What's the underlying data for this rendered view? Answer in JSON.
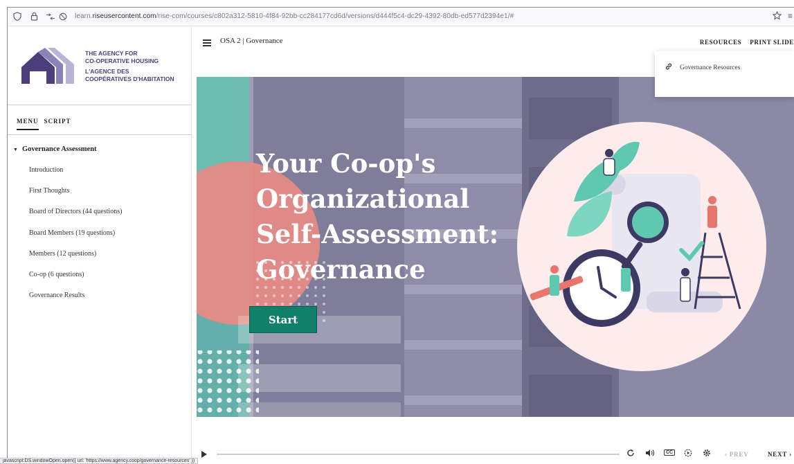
{
  "browser": {
    "url_prefix": "learn.",
    "url_domain": "riseusercontent.com",
    "url_path": "/rise-com/courses/c802a312-5810-4f84-92bb-cc284177cd6d/versions/d444f5c4-dc29-4392-80db-ed577d2394e1/#",
    "status_text": "javascript:DS.windowOpen.open({ url: 'https://www.agency.coop/governance-resources' })"
  },
  "logo": {
    "line1": "THE AGENCY FOR",
    "line2": "CO-OPERATIVE HOUSING",
    "line3": "L'AGENCE DES",
    "line4": "COOPÉRATIVES D'HABITATION",
    "colors": {
      "dark": "#4a3f7a",
      "mid": "#8b82b8",
      "light": "#b9b4d6"
    }
  },
  "sidebar": {
    "tabs": [
      {
        "label": "MENU",
        "active": true
      },
      {
        "label": "SCRIPT",
        "active": false
      }
    ],
    "section_title": "Governance Assessment",
    "lessons": [
      "Introduction",
      "First Thoughts",
      "Board of Directors (44 questions)",
      "Board Members (19 questions)",
      "Members (12 questions)",
      "Co-op (6 questions)",
      "Governance Results"
    ]
  },
  "header": {
    "course_title": "OSA 2 | Governance",
    "resources_label": "RESOURCES",
    "print_label": "PRINT SLIDE"
  },
  "dropdown": {
    "item_label": "Governance Resources"
  },
  "hero": {
    "title_line1": "Your Co-op's",
    "title_line2": "Organizational",
    "title_line3": "Self-Assessment:",
    "title_line4": "Governance",
    "start_label": "Start",
    "colors": {
      "teal": "#10806a",
      "overlay": "#7e7d9a",
      "coral": "#e58b85",
      "mint": "#5ec9b0"
    }
  },
  "player": {
    "progress_fraction": 0.0,
    "cc_label": "CC",
    "prev_label": "PREV",
    "next_label": "NEXT"
  }
}
